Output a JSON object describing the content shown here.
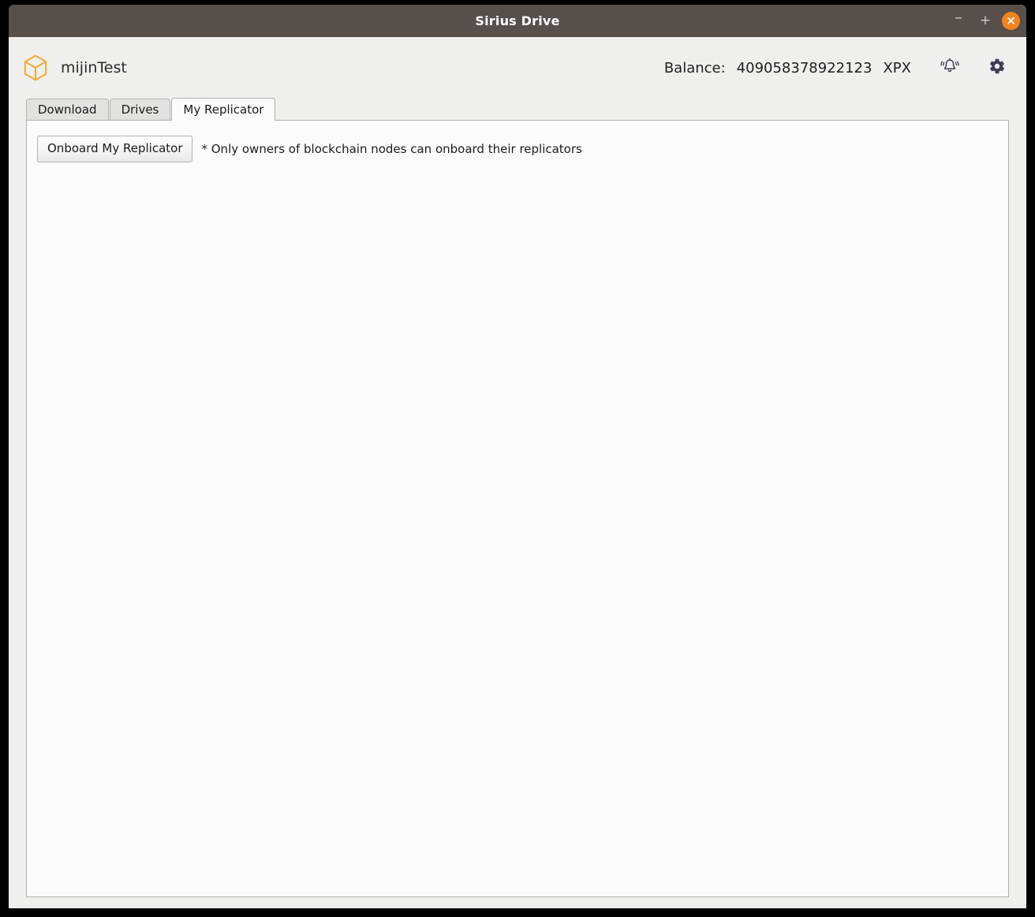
{
  "window": {
    "title": "Sirius Drive",
    "controls": {
      "minimize_label": "–",
      "maximize_label": "+",
      "close_label": "×",
      "close_color": "#f3831f"
    },
    "titlebar_color": "#574f4b"
  },
  "header": {
    "brand_name": "mijinTest",
    "logo_icon": "cube-icon",
    "logo_color": "#f0aa33",
    "balance_label": "Balance:",
    "balance_value": "409058378922123",
    "balance_unit": "XPX",
    "notification_icon": "bell-ringing-icon",
    "settings_icon": "gear-icon",
    "icon_color": "#3d3d54"
  },
  "tabs": [
    {
      "label": "Download",
      "active": false
    },
    {
      "label": "Drives",
      "active": false
    },
    {
      "label": "My Replicator",
      "active": true
    }
  ],
  "main": {
    "onboard_button_label": "Onboard My Replicator",
    "hint_text": "* Only owners of blockchain nodes can onboard their replicators"
  }
}
